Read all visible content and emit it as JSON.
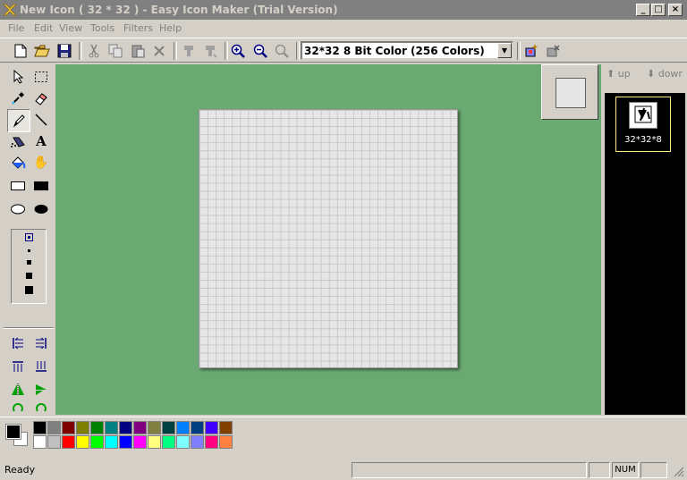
{
  "window": {
    "title": "New Icon ( 32 * 32 ) - Easy Icon Maker (Trial Version)",
    "min_glyph": "_",
    "max_glyph": "□",
    "close_glyph": "×"
  },
  "menu": [
    "File",
    "Edit",
    "View",
    "Tools",
    "Filters",
    "Help"
  ],
  "format_combo": {
    "value": "32*32  8 Bit Color (256 Colors)",
    "arrow": "▼"
  },
  "navigation": {
    "up_label": "up",
    "down_label": "dowr",
    "up_glyph": "⬆",
    "down_glyph": "⬇"
  },
  "icon_list": [
    {
      "label": "32*32*8"
    }
  ],
  "toolbox": {
    "text_tool_glyph": "A",
    "hand_glyph": "✋"
  },
  "palette": {
    "top_row": [
      "#000000",
      "#808080",
      "#800000",
      "#808000",
      "#008000",
      "#008080",
      "#000080",
      "#800080",
      "#808040",
      "#004040",
      "#0080ff",
      "#004080",
      "#4000ff",
      "#804000"
    ],
    "bottom_row": [
      "#ffffff",
      "#c0c0c0",
      "#ff0000",
      "#ffff00",
      "#00ff00",
      "#00ffff",
      "#0000ff",
      "#ff00ff",
      "#ffff80",
      "#00ff80",
      "#80ffff",
      "#8080ff",
      "#ff0080",
      "#ff8040"
    ],
    "foreground": "#000000",
    "background": "#ffffff"
  },
  "status": {
    "text": "Ready",
    "num": "NUM"
  },
  "colors": {
    "canvas_bg": "#6aaa72",
    "panel_bg": "#d4d0c8",
    "title_bg": "#808080"
  }
}
